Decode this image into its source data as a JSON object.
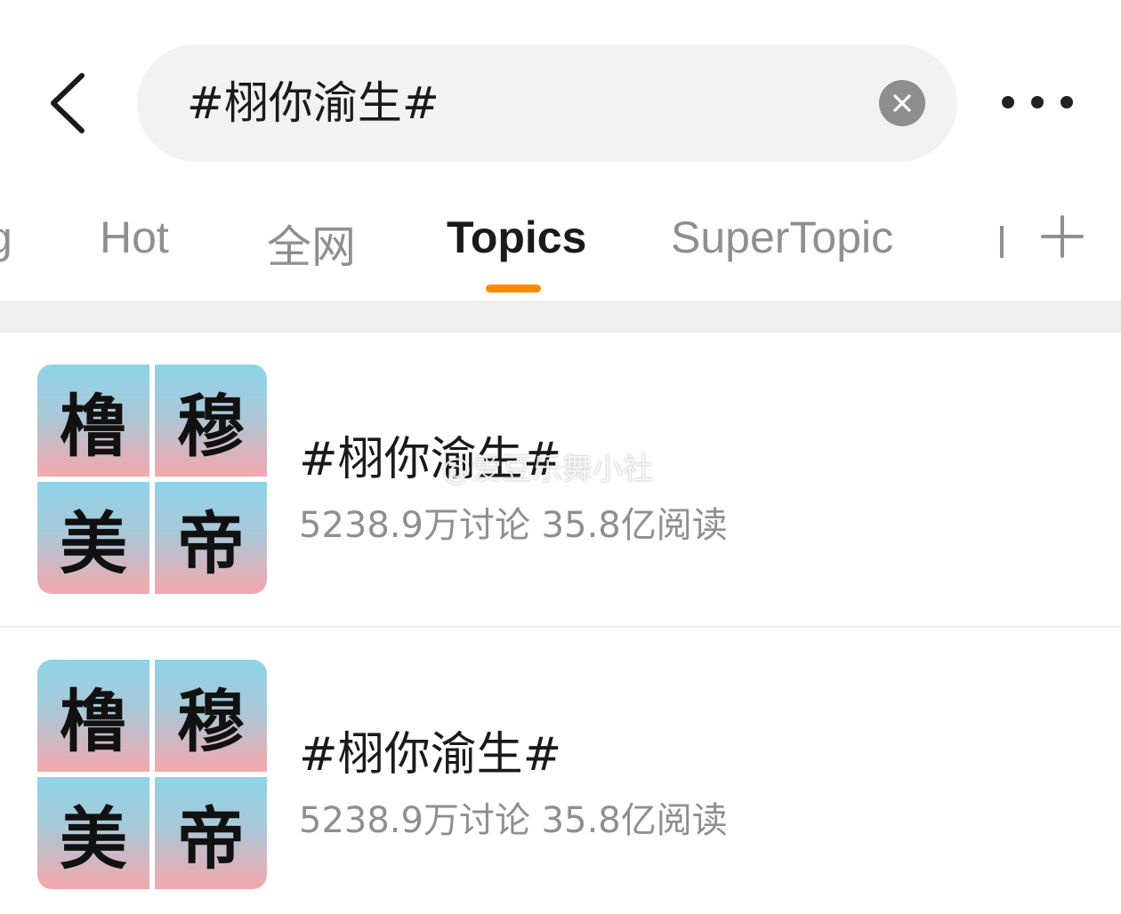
{
  "header": {
    "search_value": "#栩你渝生#"
  },
  "tabs": [
    {
      "label": "g"
    },
    {
      "label": "Hot"
    },
    {
      "label": "全网"
    },
    {
      "label": "Topics"
    },
    {
      "label": "SuperTopic"
    }
  ],
  "active_tab": "Topics",
  "colors": {
    "accent": "#ff8a00",
    "thumb_top": "#8ed3e8",
    "thumb_bottom": "#f5a7ad"
  },
  "topics": [
    {
      "title": "#栩你渝生#",
      "stats": "5238.9万讨论 35.8亿阅读",
      "thumb_chars": [
        "橹",
        "穆",
        "美",
        "帝"
      ]
    },
    {
      "title": "#栩你渝生#",
      "stats": "5238.9万讨论 35.8亿阅读",
      "thumb_chars": [
        "橹",
        "穆",
        "美",
        "帝"
      ]
    }
  ],
  "watermark": "@爱豆乐舞小社"
}
